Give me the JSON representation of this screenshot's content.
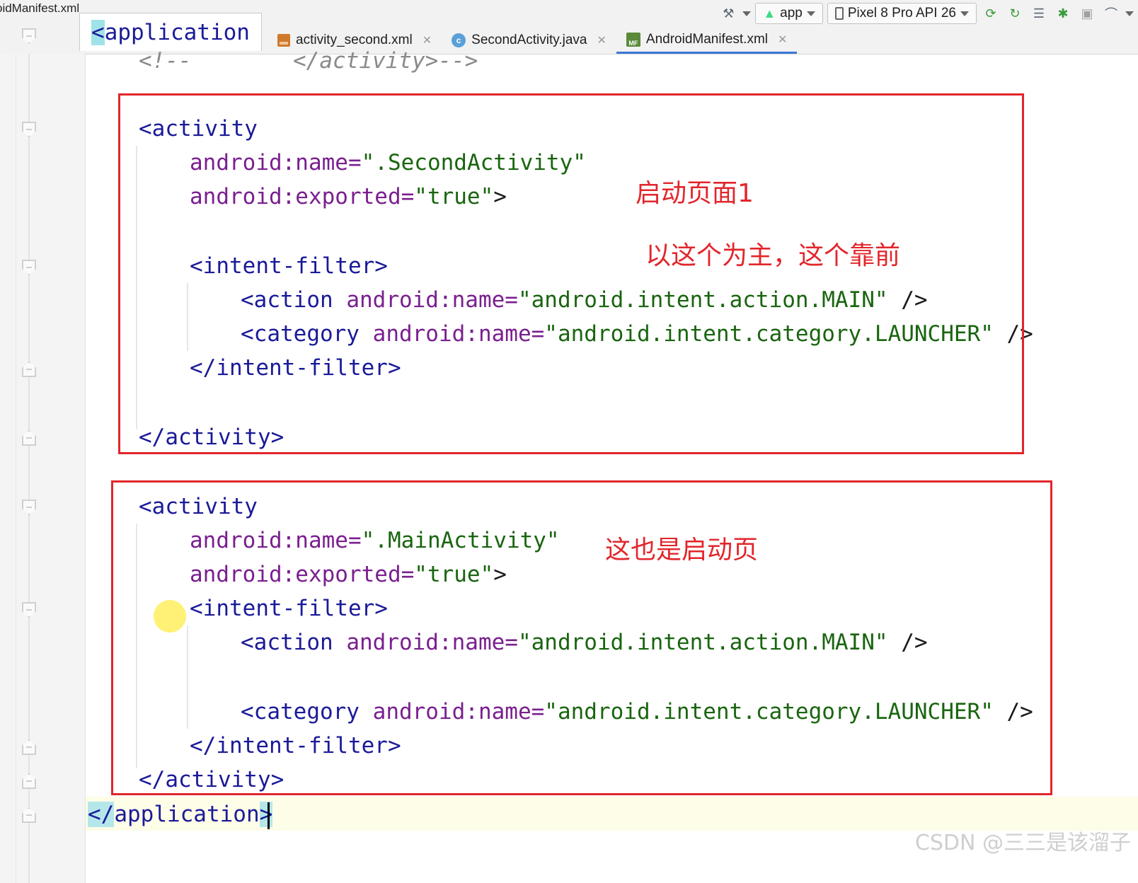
{
  "window": {
    "file_caption": "oidManifest.xml"
  },
  "breadcrumb": {
    "open_bracket": "<",
    "tag": "application"
  },
  "toolbar": {
    "hammer_icon": "hammer-icon",
    "module_combo": {
      "icon": "android-icon",
      "label": "app"
    },
    "device_combo": {
      "icon": "device-icon",
      "label": "Pixel 8 Pro API 26"
    },
    "actions": [
      "sync-icon",
      "apply-changes-icon",
      "logcat-icon",
      "bug-icon",
      "profiler-icon",
      "more-icon"
    ]
  },
  "tabs": [
    {
      "label": "activity_second.xml",
      "icon": "xml-file-icon",
      "active": false
    },
    {
      "label": "SecondActivity.java",
      "icon": "java-class-icon",
      "active": false
    },
    {
      "label": "AndroidManifest.xml",
      "icon": "manifest-file-icon",
      "active": true
    }
  ],
  "code": {
    "comment_open": "<!--",
    "comment_close": "</activity>-->",
    "block1": {
      "open": "<activity",
      "name_attr": "android:name=",
      "name_val": "\".SecondActivity\"",
      "exported_attr": "android:exported=",
      "exported_val": "\"true\"",
      "exported_end": ">",
      "if_open": "<intent-filter>",
      "action_tag": "<action",
      "action_attr": "android:name=",
      "action_val": "\"android.intent.action.MAIN\"",
      "action_end": " />",
      "cat_tag": "<category",
      "cat_attr": "android:name=",
      "cat_val": "\"android.intent.category.LAUNCHER\"",
      "cat_end": " />",
      "if_close": "</intent-filter>",
      "close": "</activity>"
    },
    "block2": {
      "open": "<activity",
      "name_attr": "android:name=",
      "name_val": "\".MainActivity\"",
      "exported_attr": "android:exported=",
      "exported_val": "\"true\"",
      "exported_end": ">",
      "if_open": "<intent-filter>",
      "action_tag": "<action",
      "action_attr": "android:name=",
      "action_val": "\"android.intent.action.MAIN\"",
      "action_end": " />",
      "cat_tag": "<category",
      "cat_attr": "android:name=",
      "cat_val": "\"android.intent.category.LAUNCHER\"",
      "cat_end": " />",
      "if_close": "</intent-filter>",
      "close": "</activity>"
    },
    "app_close_prefix": "</",
    "app_close_tag": "application",
    "app_close_end": ">"
  },
  "annotations": {
    "note1": "启动页面1",
    "note2": "以这个为主，这个靠前",
    "note3": "这也是启动页",
    "color": "#e2262b"
  },
  "watermark": "CSDN @三三是该溜子"
}
